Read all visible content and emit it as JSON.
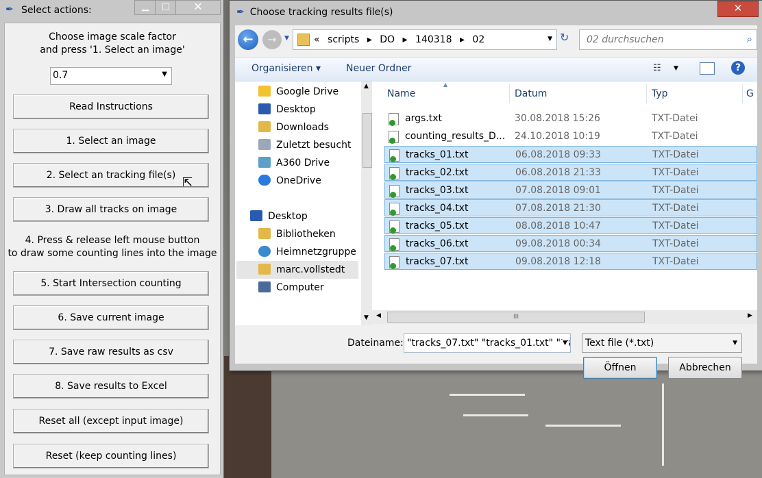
{
  "left_window": {
    "title": "Select actions:",
    "title_buttons": {
      "minimize": "▁",
      "maximize": "□",
      "close": "✕"
    },
    "instruction_top": [
      "Choose image scale factor",
      "and press '1. Select an image'"
    ],
    "scale_factor": {
      "value": "0.7",
      "dropdown_icon": "▼"
    },
    "instruction_mid": [
      "4. Press & release left mouse button",
      "to draw some counting lines into the image"
    ],
    "buttons": {
      "read": "Read Instructions",
      "b1": "1. Select an image",
      "b2": "2. Select an tracking file(s)",
      "b3": "3. Draw all tracks on image",
      "b5": "5. Start Intersection counting",
      "b6": "6. Save current image",
      "b7": "7. Save raw results as csv",
      "b8": "8. Save results to Excel",
      "reset_all": "Reset all (except input image)",
      "reset_keep": "Reset (keep counting lines)"
    }
  },
  "dialog": {
    "title": "Choose tracking results file(s)",
    "close": "✕",
    "nav": {
      "back": "←",
      "forward": "→",
      "dropdown": "▼"
    },
    "address": {
      "prefix": "«",
      "crumbs": [
        "scripts",
        "DO",
        "140318",
        "02"
      ],
      "separator": "▸",
      "dropdown": "▼"
    },
    "refresh": "↻",
    "search": {
      "placeholder": "02 durchsuchen",
      "icon": "⌕"
    },
    "toolbar": {
      "organize": "Organisieren ▾",
      "new_folder": "Neuer Ordner",
      "view_icon": "☷",
      "view_dd": "▼",
      "help": "?"
    },
    "nav_pane": [
      {
        "label": "Google Drive",
        "color": "#f2c230"
      },
      {
        "label": "Desktop",
        "color": "#2a5ab0"
      },
      {
        "label": "Downloads",
        "color": "#e2b848"
      },
      {
        "label": "Zuletzt besucht",
        "color": "#9aa8b8"
      },
      {
        "label": "A360 Drive",
        "color": "#5aa0c8"
      },
      {
        "label": "OneDrive",
        "color": "#2a7ae0"
      },
      {
        "label": "Desktop",
        "color": "#2a5ab0"
      },
      {
        "label": "Bibliotheken",
        "color": "#e2b848"
      },
      {
        "label": "Heimnetzgruppe",
        "color": "#3a8ad0"
      },
      {
        "label": "marc.vollstedt",
        "color": "#e2b848"
      },
      {
        "label": "Computer",
        "color": "#4a6a9a"
      }
    ],
    "columns": {
      "name": "Name",
      "date": "Datum",
      "type": "Typ",
      "extra": "G"
    },
    "files": [
      {
        "name": "args.txt",
        "date": "30.08.2018 15:26",
        "type": "TXT-Datei",
        "selected": false
      },
      {
        "name": "counting_results_D...",
        "date": "24.10.2018 10:19",
        "type": "TXT-Datei",
        "selected": false
      },
      {
        "name": "tracks_01.txt",
        "date": "06.08.2018 09:33",
        "type": "TXT-Datei",
        "selected": true
      },
      {
        "name": "tracks_02.txt",
        "date": "06.08.2018 21:33",
        "type": "TXT-Datei",
        "selected": true
      },
      {
        "name": "tracks_03.txt",
        "date": "07.08.2018 09:01",
        "type": "TXT-Datei",
        "selected": true
      },
      {
        "name": "tracks_04.txt",
        "date": "07.08.2018 21:30",
        "type": "TXT-Datei",
        "selected": true
      },
      {
        "name": "tracks_05.txt",
        "date": "08.08.2018 10:47",
        "type": "TXT-Datei",
        "selected": true
      },
      {
        "name": "tracks_06.txt",
        "date": "09.08.2018 00:34",
        "type": "TXT-Datei",
        "selected": true
      },
      {
        "name": "tracks_07.txt",
        "date": "09.08.2018 12:18",
        "type": "TXT-Datei",
        "selected": true
      }
    ],
    "filename": {
      "label": "Dateiname:",
      "value": "\"tracks_07.txt\" \"tracks_01.txt\" \"tra",
      "dropdown": "▼"
    },
    "filter": {
      "value": "Text file (*.txt)",
      "dropdown": "▼"
    },
    "open": "Öffnen",
    "cancel": "Abbrechen",
    "scroll": {
      "up": "▲",
      "down": "▼",
      "left": "◀",
      "right": "▶",
      "grip": "III"
    }
  }
}
